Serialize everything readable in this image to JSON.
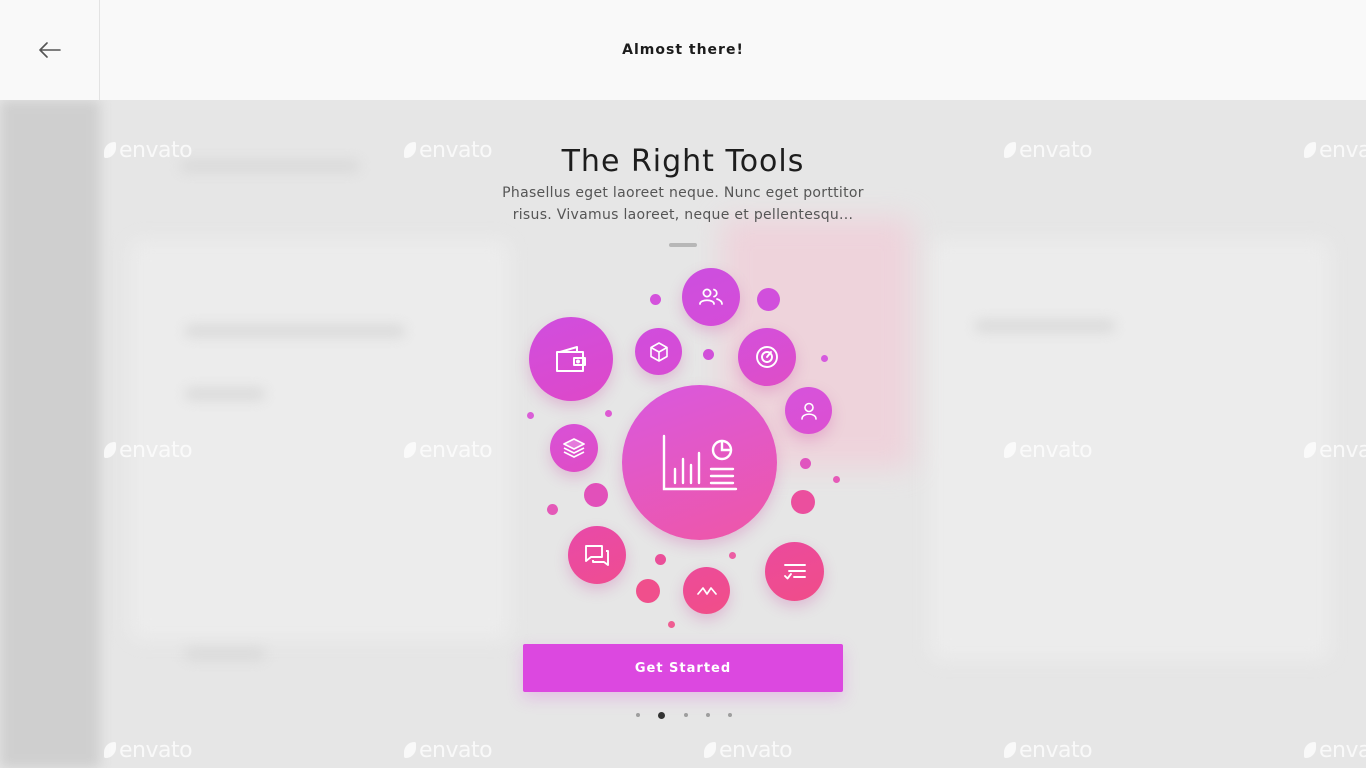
{
  "header": {
    "title": "Almost there!",
    "back_icon": "arrow-left-icon"
  },
  "main": {
    "heading": "The Right Tools",
    "description": "Phasellus eget laoreet neque. Nunc eget porttitor risus. Vivamus laoreet, neque et pellentesqu...",
    "cta_label": "Get Started"
  },
  "pager": {
    "total": 5,
    "active_index": 1
  },
  "illustration": {
    "icons": [
      "chart-icon",
      "wallet-icon",
      "users-icon",
      "box-icon",
      "gauge-icon",
      "user-icon",
      "layers-icon",
      "chat-icon",
      "activity-icon",
      "list-check-icon"
    ]
  },
  "watermark": "envato",
  "colors": {
    "accent": "#dc48e0",
    "bubble_top": "#d54ede",
    "bubble_bottom": "#f0508d",
    "background": "#e4e4e4",
    "header_bg": "#f9f9f9"
  }
}
